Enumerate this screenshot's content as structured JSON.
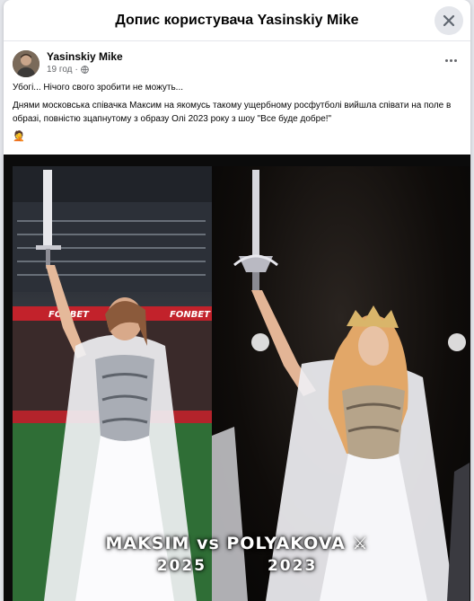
{
  "dialog": {
    "title": "Допис користувача Yasinskiy Mike"
  },
  "post": {
    "author": "Yasinskiy Mike",
    "time": "19 год",
    "separator": "·",
    "text_line1": "Убогі... Нічого свого зробити не можуть...",
    "text_line2": "Днями московська співачка Максим на якомусь такому ущербному росфутболі вийшла співати на поле в образі, повністю зцапнутому з образу Олі 2023 року з шоу \"Все буде добре!\"",
    "emoji": "🤦"
  },
  "media": {
    "caption_main": "MAKSIM vs POLYAKOVA ⚔",
    "caption_years": "2025 2023",
    "banner_left": "FONBET",
    "banner_right": "FONBET"
  },
  "icons": {
    "close": "close-icon",
    "globe": "globe-icon",
    "more": "more-icon"
  },
  "colors": {
    "header_bg": "#ffffff",
    "secondary_text": "#65676b",
    "close_bg": "#e4e6eb"
  }
}
